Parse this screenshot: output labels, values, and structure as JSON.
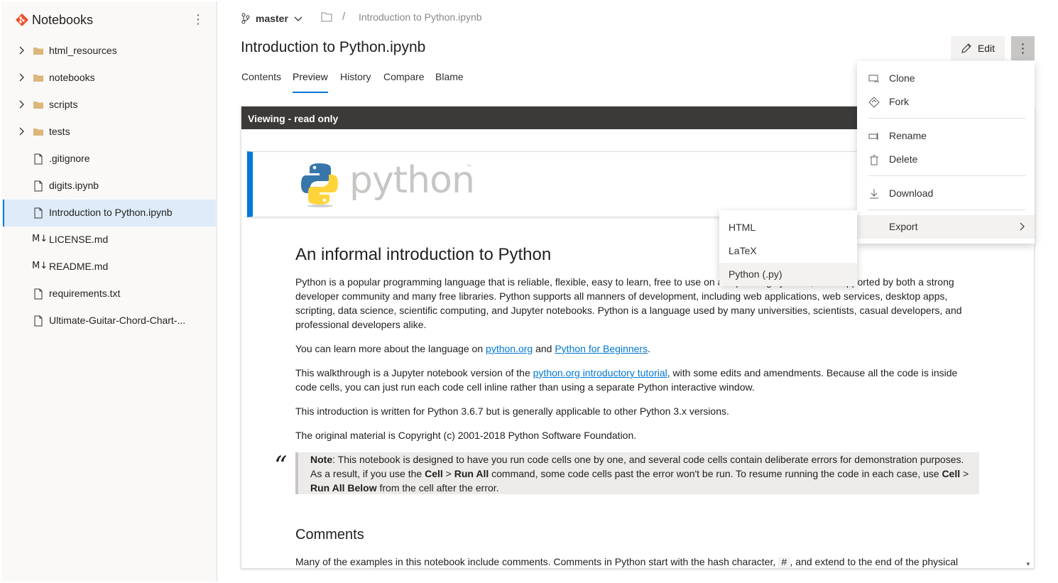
{
  "sidebar": {
    "title": "Notebooks",
    "items": [
      {
        "label": "html_resources",
        "type": "folder"
      },
      {
        "label": "notebooks",
        "type": "folder"
      },
      {
        "label": "scripts",
        "type": "folder"
      },
      {
        "label": "tests",
        "type": "folder"
      },
      {
        "label": ".gitignore",
        "type": "file"
      },
      {
        "label": "digits.ipynb",
        "type": "file"
      },
      {
        "label": "Introduction to Python.ipynb",
        "type": "file",
        "selected": true
      },
      {
        "label": "LICENSE.md",
        "type": "markdown"
      },
      {
        "label": "README.md",
        "type": "markdown"
      },
      {
        "label": "requirements.txt",
        "type": "file"
      },
      {
        "label": "Ultimate-Guitar-Chord-Chart-...",
        "type": "file"
      }
    ],
    "md_glyph": "M↓"
  },
  "header": {
    "branch": "master",
    "breadcrumb_sep": "/",
    "breadcrumb_file": "Introduction to Python.ipynb",
    "title": "Introduction to Python.ipynb",
    "edit_label": "Edit",
    "more_glyph": "⋮"
  },
  "tabs": [
    "Contents",
    "Preview",
    "History",
    "Compare",
    "Blame"
  ],
  "active_tab": "Preview",
  "viewer": {
    "banner": "Viewing - read only",
    "logo_word": "python",
    "logo_tm": "™",
    "h1": "An informal introduction to Python",
    "p1": "Python is a popular programming language that is reliable, flexible, easy to learn, free to use on all operating systems, and supported by both a strong developer community and many free libraries. Python supports all manners of development, including web applications, web services, desktop apps, scripting, data science, scientific computing, and Jupyter notebooks. Python is a language used by many universities, scientists, casual developers, and professional developers alike.",
    "p2_a": "You can learn more about the language on ",
    "p2_link1": "python.org",
    "p2_b": " and ",
    "p2_link2": "Python for Beginners",
    "p2_c": ".",
    "p3_a": "This walkthrough is a Jupyter notebook version of the ",
    "p3_link": "python.org introductory tutorial",
    "p3_b": ", with some edits and amendments. Because all the code is inside code cells, you can just run each code cell inline rather than using a separate Python interactive window.",
    "p4": "This introduction is written for Python 3.6.7 but is generally applicable to other Python 3.x versions.",
    "p5": "The original material is Copyright (c) 2001-2018 Python Software Foundation.",
    "quote_glyph": "“",
    "note_bold": "Note",
    "note_a": ": This notebook is designed to have you run code cells one by one, and several code cells contain deliberate errors for demonstration purposes. As a result, if you use the ",
    "note_cell": "Cell",
    "note_gt1": " > ",
    "note_runall": "Run All",
    "note_b": " command, some code cells past the error won't be run. To resume running the code in each case, use ",
    "note_cell2": "Cell",
    "note_gt2": " > ",
    "note_runallbelow": "Run All Below",
    "note_c": " from the cell after the error.",
    "h2": "Comments",
    "p6_a": "Many of the examples in this notebook include comments. Comments in Python start with the hash character, ",
    "p6_code": "#",
    "p6_b": ", and extend to the end of the physical"
  },
  "menu": {
    "items": [
      "Clone",
      "Fork",
      "Rename",
      "Delete",
      "Download",
      "Export"
    ]
  },
  "export_menu": {
    "items": [
      "HTML",
      "LaTeX",
      "Python (.py)"
    ]
  },
  "colors": {
    "accent": "#0078d4",
    "banner": "#3b3a39",
    "selected": "#deecf9"
  }
}
